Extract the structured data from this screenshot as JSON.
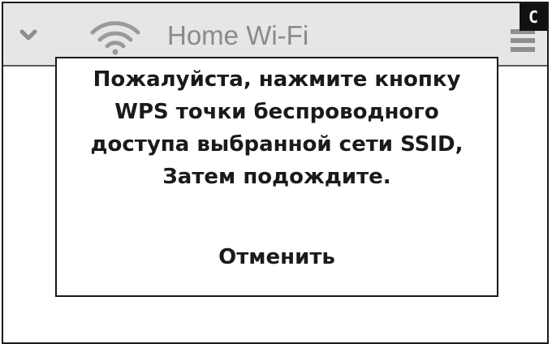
{
  "header": {
    "ssid_label": "Home Wi-Fi",
    "chevron_icon": "chevron-down-icon",
    "wifi_icon": "wifi-icon",
    "menu_icon": "menu-icon",
    "corner_badge": "C"
  },
  "dialog": {
    "message_lines": [
      "Пожалуйста, нажмите кнопку",
      "WPS точки беспроводного",
      "доступа выбранной сети SSID,",
      "Затем подождите."
    ],
    "cancel_label": "Отменить"
  },
  "colors": {
    "header_background": "#e6e6e6",
    "header_text": "#8a8a8a",
    "icon_gray": "#9a9a9a",
    "dialog_text": "#1a1a1a",
    "border": "#1a1a1a"
  }
}
